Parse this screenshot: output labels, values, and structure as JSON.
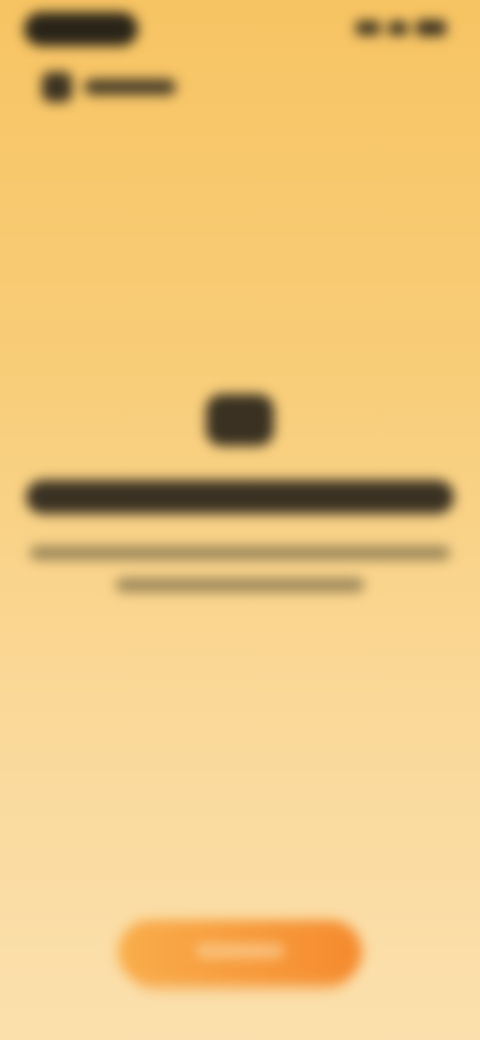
{
  "theme": {
    "background_top": "#f7c463",
    "background_bottom": "#fbe0ad",
    "accent": "#f58a2e",
    "text_dark": "#3a3122"
  },
  "status_bar": {
    "icons": [
      "signal-icon",
      "wifi-icon",
      "battery-icon"
    ]
  },
  "nav": {
    "back_icon": "back-icon"
  },
  "content": {
    "icon": "hero-icon"
  },
  "cta": {
    "style": "primary-orange-pill"
  }
}
